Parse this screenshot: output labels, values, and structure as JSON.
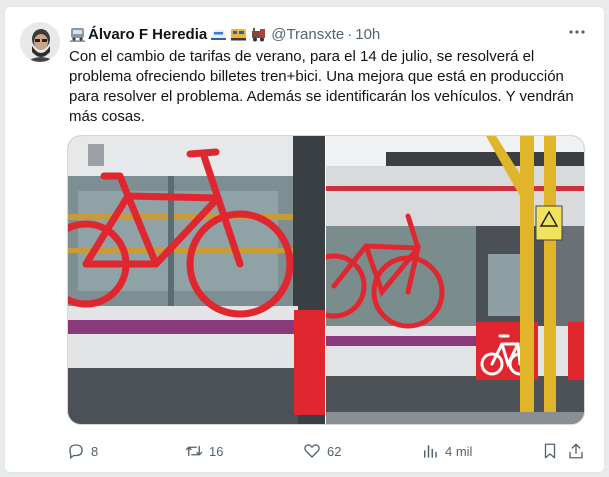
{
  "tweet": {
    "author_name": "Álvaro F Heredia",
    "handle": "@Transxte",
    "separator": "·",
    "time": "10h",
    "text": "Con el cambio de tarifas de verano, para el 14 de julio, se resolverá el problema ofreciendo billetes tren+bici. Una mejora que está en producción para resolver el problema. Además se identificarán los vehículos. Y vendrán más cosas.",
    "more_icon": "more-dots-icon"
  },
  "actions": {
    "replies": "8",
    "retweets": "16",
    "likes": "62",
    "views": "4 mil"
  },
  "colors": {
    "text": "#0f1419",
    "secondary": "#536471",
    "bike_red": "#e0262f"
  }
}
